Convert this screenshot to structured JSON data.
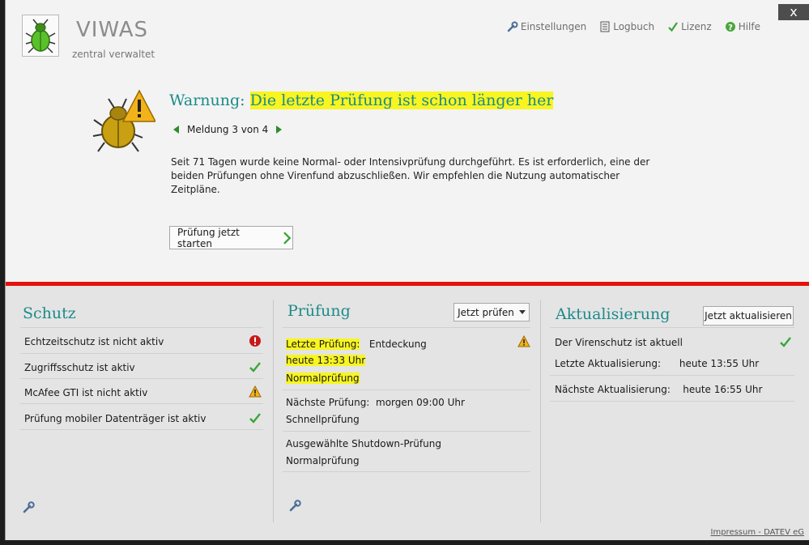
{
  "header": {
    "app_title": "VIWAS",
    "app_subtitle": "zentral verwaltet",
    "nav": [
      {
        "label": "Einstellungen",
        "icon": "wrench-icon"
      },
      {
        "label": "Logbuch",
        "icon": "logbook-icon"
      },
      {
        "label": "Lizenz",
        "icon": "check-icon"
      },
      {
        "label": "Hilfe",
        "icon": "help-icon"
      }
    ],
    "close_glyph": "x"
  },
  "warning": {
    "prefix": "Warnung: ",
    "title": "Die letzte Prüfung ist schon länger her",
    "counter": "Meldung 3 von 4",
    "text": "Seit 71 Tagen wurde keine Normal- oder Intensivprüfung durchgeführt. Es ist erforderlich, eine der beiden Prüfungen ohne Virenfund abzuschließen. Wir empfehlen die Nutzung automatischer Zeitpläne.",
    "action_label": "Prüfung jetzt starten"
  },
  "schutz": {
    "title": "Schutz",
    "items": [
      {
        "label": "Echtzeitschutz ist nicht aktiv",
        "status": "error"
      },
      {
        "label": "Zugriffsschutz ist aktiv",
        "status": "ok"
      },
      {
        "label": "McAfee GTI ist nicht aktiv",
        "status": "warning"
      },
      {
        "label": "Prüfung mobiler Datenträger ist aktiv",
        "status": "ok"
      }
    ]
  },
  "pruefung": {
    "title": "Prüfung",
    "menu_label": "Jetzt prüfen",
    "last_label": "Letzte Prüfung:",
    "last_value": "Entdeckung",
    "last_time": "heute 13:33 Uhr",
    "last_type": "Normalprüfung",
    "next_label": "Nächste Prüfung:",
    "next_value": "morgen 09:00 Uhr",
    "next_type": "Schnellprüfung",
    "shutdown_label": "Ausgewählte Shutdown-Prüfung",
    "shutdown_type": "Normalprüfung"
  },
  "update": {
    "title": "Aktualisierung",
    "button_label": "Jetzt aktualisieren",
    "status": "Der Virenschutz ist aktuell",
    "last_label": "Letzte Aktualisierung:",
    "last_value": "heute 13:55 Uhr",
    "next_label": "Nächste Aktualisierung:",
    "next_value": "heute 16:55 Uhr"
  },
  "footer": {
    "link": "Impressum - DATEV eG"
  },
  "colors": {
    "accent": "#1d8a8a",
    "alert_line": "#e3120b",
    "highlight": "#f8f520",
    "ok": "#3aa53a",
    "error": "#c81a1a",
    "warning": "#f2b21a"
  }
}
